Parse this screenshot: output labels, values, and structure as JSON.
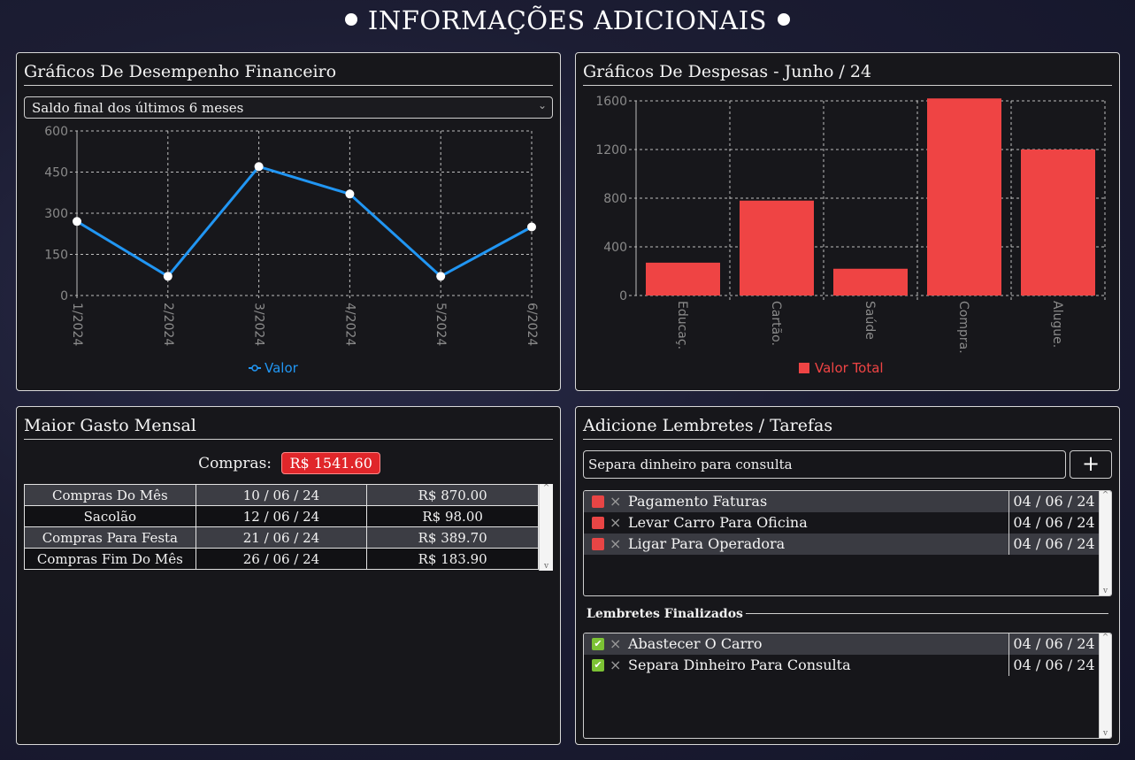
{
  "page": {
    "title": "INFORMAÇÕES ADICIONAIS"
  },
  "finance_chart": {
    "title": "Gráficos De Desempenho Financeiro",
    "select_value": "Saldo final dos últimos 6 meses"
  },
  "expense_chart": {
    "title": "Gráficos De Despesas - Junho / 24"
  },
  "chart_data": [
    {
      "type": "line",
      "categories": [
        "1/2024",
        "2/2024",
        "3/2024",
        "4/2024",
        "5/2024",
        "6/2024"
      ],
      "series": [
        {
          "name": "Valor",
          "values": [
            270,
            70,
            470,
            370,
            70,
            250
          ]
        }
      ],
      "yticks": [
        0,
        150,
        300,
        450,
        600
      ],
      "ylim": [
        0,
        600
      ],
      "grid": true,
      "legend": "bottom",
      "color": "#2196f3"
    },
    {
      "type": "bar",
      "categories": [
        "Educaç.",
        "Cartão.",
        "Saúde",
        "Compra.",
        "Alugue."
      ],
      "series": [
        {
          "name": "Valor Total",
          "values": [
            270,
            780,
            220,
            1620,
            1200
          ]
        }
      ],
      "yticks": [
        0,
        400,
        800,
        1200,
        1600
      ],
      "ylim": [
        0,
        1600
      ],
      "grid": true,
      "legend": "bottom",
      "color": "#ef4444"
    }
  ],
  "maior_gasto": {
    "title": "Maior Gasto Mensal",
    "category_label": "Compras:",
    "amount": "R$ 1541.60",
    "rows": [
      {
        "name": "Compras Do Mês",
        "date": "10 / 06 / 24",
        "value": "R$ 870.00"
      },
      {
        "name": "Sacolão",
        "date": "12 / 06 / 24",
        "value": "R$ 98.00"
      },
      {
        "name": "Compras Para Festa",
        "date": "21 / 06 / 24",
        "value": "R$ 389.70"
      },
      {
        "name": "Compras Fim Do Mês",
        "date": "26 / 06 / 24",
        "value": "R$ 183.90"
      }
    ]
  },
  "lembretes": {
    "title": "Adicione Lembretes / Tarefas",
    "input_value": "Separa dinheiro para consulta",
    "add_label": "+",
    "pending": [
      {
        "label": "Pagamento Faturas",
        "date": "04 / 06 / 24"
      },
      {
        "label": "Levar Carro Para Oficina",
        "date": "04 / 06 / 24"
      },
      {
        "label": "Ligar Para Operadora",
        "date": "04 / 06 / 24"
      }
    ],
    "finished_title": "Lembretes Finalizados",
    "finished": [
      {
        "label": "Abastecer O Carro",
        "date": "04 / 06 / 24"
      },
      {
        "label": "Separa Dinheiro Para Consulta",
        "date": "04 / 06 / 24"
      }
    ]
  },
  "icons": {
    "remove": "×",
    "check": "✔",
    "scroll_up": "^",
    "scroll_down": "v",
    "select_chevron": "⌄"
  }
}
